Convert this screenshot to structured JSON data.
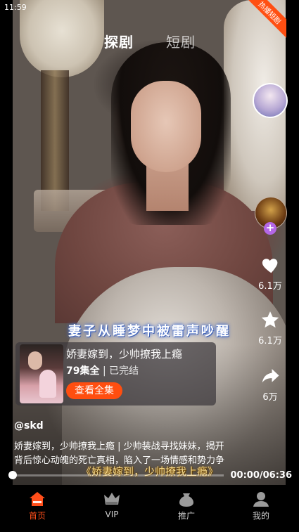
{
  "status_bar": {
    "time": "11:59"
  },
  "top_tabs": [
    {
      "label": "探剧",
      "active": true
    },
    {
      "label": "短剧",
      "active": false
    }
  ],
  "corner_badge": "热播短剧",
  "actions": {
    "like_count": "6.1万",
    "favorite_count": "6.1万",
    "share_count": "6万"
  },
  "video": {
    "subtitle": "妻子从睡梦中被雷声吵醒",
    "overlay_title": "《娇妻嫁到，少帅撩我上瘾》",
    "progress": 0,
    "time": "00:00/06:36"
  },
  "drama_card": {
    "title": "娇妻嫁到，少帅撩我上瘾",
    "episodes": "79集全",
    "status": "| 已完结",
    "button": "查看全集"
  },
  "author": "@skd",
  "description": "娇妻嫁到，少帅撩我上瘾 | 少帅装战寻找妹妹，揭开背后惊心动魄的死亡真相，陷入了一场情感和势力争",
  "bottom_nav": [
    {
      "label": "首页",
      "icon": "home-icon",
      "active": true
    },
    {
      "label": "VIP",
      "icon": "crown-icon",
      "active": false
    },
    {
      "label": "推广",
      "icon": "promote-bag-icon",
      "active": false
    },
    {
      "label": "我的",
      "icon": "profile-icon",
      "active": false
    }
  ],
  "colors": {
    "accent": "#ff4e10",
    "follow_plus": "#b467e6"
  }
}
